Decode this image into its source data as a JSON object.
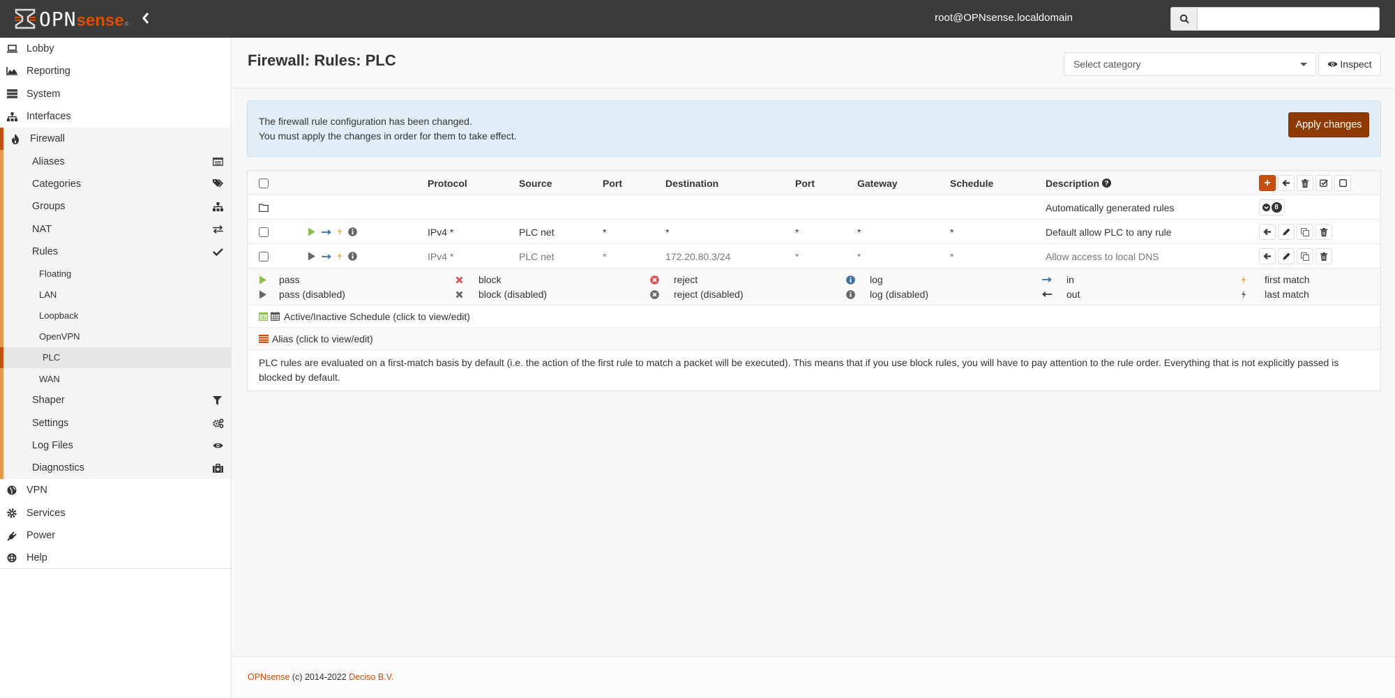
{
  "navbar": {
    "logo_main": "OPN",
    "logo_accent": "sense",
    "logo_reg": "®",
    "collapse_icon": "chevron-left-icon",
    "user": "root@OPNsense.localdomain",
    "search_icon": "search-icon",
    "search_value": ""
  },
  "sidebar": {
    "items": [
      {
        "label": "Lobby",
        "icon": "laptop-icon"
      },
      {
        "label": "Reporting",
        "icon": "area-chart-icon"
      },
      {
        "label": "System",
        "icon": "server-icon"
      },
      {
        "label": "Interfaces",
        "icon": "sitemap-icon"
      },
      {
        "label": "Firewall",
        "icon": "fire-icon"
      },
      {
        "label": "VPN",
        "icon": "globe-icon"
      },
      {
        "label": "Services",
        "icon": "cog-icon"
      },
      {
        "label": "Power",
        "icon": "plug-icon"
      },
      {
        "label": "Help",
        "icon": "life-ring-icon"
      }
    ],
    "firewall_sub": [
      {
        "label": "Aliases",
        "icon": "list-alt-icon"
      },
      {
        "label": "Categories",
        "icon": "tags-icon"
      },
      {
        "label": "Groups",
        "icon": "sitemap-icon"
      },
      {
        "label": "NAT",
        "icon": "exchange-icon"
      },
      {
        "label": "Rules",
        "icon": "check-icon"
      },
      {
        "label": "Shaper",
        "icon": "filter-icon"
      },
      {
        "label": "Settings",
        "icon": "cogs-icon"
      },
      {
        "label": "Log Files",
        "icon": "eye-icon"
      },
      {
        "label": "Diagnostics",
        "icon": "medkit-icon"
      }
    ],
    "rules_sub": [
      "Floating",
      "LAN",
      "Loopback",
      "OpenVPN",
      "PLC",
      "WAN"
    ],
    "active_rule_interface": "PLC"
  },
  "page": {
    "title": "Firewall: Rules: PLC",
    "category_placeholder": "Select category",
    "inspect_label": "Inspect"
  },
  "alert": {
    "line1": "The firewall rule configuration has been changed.",
    "line2": "You must apply the changes in order for them to take effect.",
    "apply_label": "Apply changes"
  },
  "table": {
    "headers": {
      "protocol": "Protocol",
      "source": "Source",
      "source_port": "Port",
      "destination": "Destination",
      "dest_port": "Port",
      "gateway": "Gateway",
      "schedule": "Schedule",
      "description": "Description"
    },
    "auto_rules": {
      "description": "Automatically generated rules",
      "count": "8"
    },
    "rules": [
      {
        "action": "pass",
        "enabled": true,
        "direction": "in",
        "quick": true,
        "log": false,
        "protocol": "IPv4 *",
        "source": "PLC net",
        "source_port": "*",
        "destination": "*",
        "dest_port": "*",
        "gateway": "*",
        "schedule": "*",
        "description": "Default allow PLC to any rule"
      },
      {
        "action": "pass",
        "enabled": false,
        "direction": "in",
        "quick": true,
        "log": false,
        "protocol": "IPv4 *",
        "source": "PLC net",
        "source_port": "*",
        "destination": "172.20.80.3/24",
        "dest_port": "*",
        "gateway": "*",
        "schedule": "*",
        "description": "Allow access to local DNS"
      }
    ]
  },
  "legend": {
    "pass": "pass",
    "pass_disabled": "pass (disabled)",
    "block": "block",
    "block_disabled": "block (disabled)",
    "reject": "reject",
    "reject_disabled": "reject (disabled)",
    "log": "log",
    "log_disabled": "log (disabled)",
    "in": "in",
    "out": "out",
    "first_match": "first match",
    "last_match": "last match"
  },
  "schedule_info": "Active/Inactive Schedule (click to view/edit)",
  "alias_info": "Alias (click to view/edit)",
  "note": "PLC rules are evaluated on a first-match basis by default (i.e. the action of the first rule to match a packet will be executed). This means that if you use block rules, you will have to pay attention to the rule order. Everything that is not explicitly passed is blocked by default.",
  "footer": {
    "brand": "OPNsense",
    "copyright": " (c) 2014-2022 ",
    "company": "Deciso B.V."
  },
  "colors": {
    "brand": "#c64e0f",
    "apply": "#8f3a02",
    "pass": "#8cc152",
    "block": "#d9534f",
    "in_arrow": "#3c6e9e",
    "quick": "#f0ad4e"
  }
}
